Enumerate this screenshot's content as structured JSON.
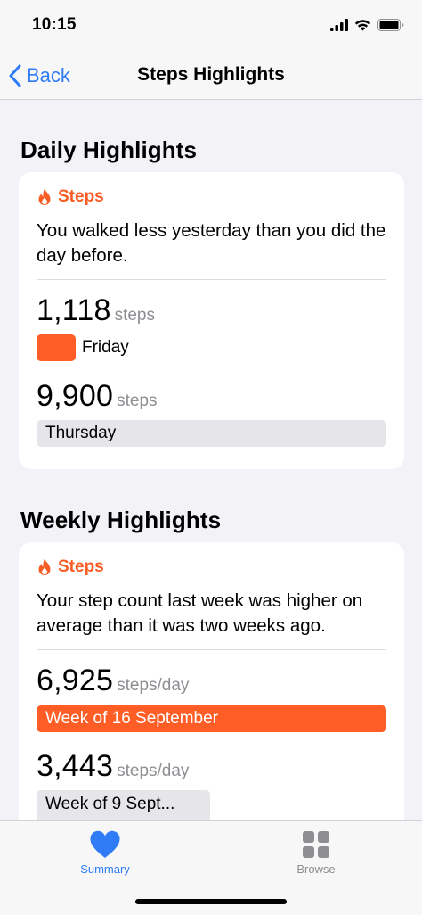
{
  "status_bar": {
    "time": "10:15"
  },
  "nav": {
    "back_label": "Back",
    "title": "Steps Highlights"
  },
  "daily": {
    "section_title": "Daily Highlights",
    "category": "Steps",
    "description": "You walked less yesterday than you did the day before.",
    "metrics": [
      {
        "value": "1,118",
        "unit": "steps",
        "label": "",
        "bar_label": "Friday",
        "fill_fraction": 0.113
      },
      {
        "value": "9,900",
        "unit": "steps",
        "bar_label": "Thursday",
        "fill_fraction": 1.0
      }
    ]
  },
  "weekly": {
    "section_title": "Weekly Highlights",
    "category": "Steps",
    "description": "Your step count last week was higher on average than it was two weeks ago.",
    "metrics": [
      {
        "value": "6,925",
        "unit": "steps/day",
        "bar_label": "Week of 16 September",
        "fill_fraction": 1.0
      },
      {
        "value": "3,443",
        "unit": "steps/day",
        "bar_label": "Week of 9 Sept...",
        "fill_fraction": 0.497
      }
    ]
  },
  "tabs": [
    {
      "label": "Summary",
      "icon": "heart-icon",
      "active": true
    },
    {
      "label": "Browse",
      "icon": "grid-icon",
      "active": false
    }
  ],
  "colors": {
    "accent": "#2f7cf6",
    "orange": "#ff5d26",
    "grey_bar": "#e5e5ea",
    "secondary_text": "#8e8e93"
  }
}
